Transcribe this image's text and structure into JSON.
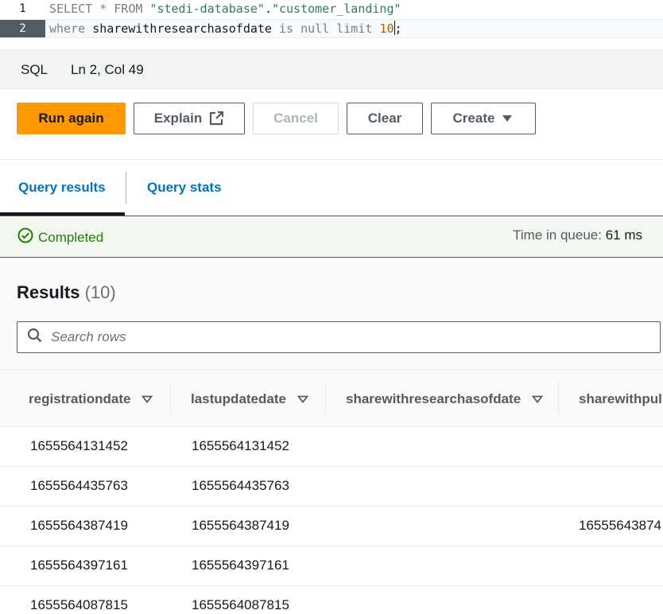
{
  "editor": {
    "line1_num": "1",
    "line2_num": "2",
    "line1": {
      "select": "SELECT * FROM ",
      "db": "\"stedi-database\"",
      "dot": ".",
      "table": "\"customer_landing\""
    },
    "line2": {
      "where": "where ",
      "field": "sharewithresearchasofdate",
      "is": " is ",
      "null": "null",
      "limit": " limit ",
      "num_a": "10",
      "num_b": "",
      "semi": ";"
    }
  },
  "status": {
    "language": "SQL",
    "position": "Ln 2, Col 49"
  },
  "actions": {
    "run_again": "Run again",
    "explain": "Explain",
    "cancel": "Cancel",
    "clear": "Clear",
    "create": "Create"
  },
  "tabs": {
    "results": "Query results",
    "stats": "Query stats"
  },
  "alert": {
    "status": "Completed",
    "queue_label": "Time in queue:",
    "queue_value": "61 ms"
  },
  "results": {
    "title": "Results",
    "count": "(10)",
    "search_placeholder": "Search rows"
  },
  "table": {
    "columns": [
      "registrationdate",
      "lastupdatedate",
      "sharewithresearchasofdate",
      "sharewithpul"
    ],
    "rows": [
      [
        "1655564131452",
        "1655564131452",
        "",
        ""
      ],
      [
        "1655564435763",
        "1655564435763",
        "",
        ""
      ],
      [
        "1655564387419",
        "1655564387419",
        "",
        "16555643874"
      ],
      [
        "1655564397161",
        "1655564397161",
        "",
        ""
      ],
      [
        "1655564087815",
        "1655564087815",
        "",
        ""
      ]
    ]
  },
  "colors": {
    "primary": "#ff9900",
    "link": "#0073bb",
    "success": "#1d8102"
  },
  "icons": [
    "external-link-icon",
    "caret-down-icon",
    "check-circle-icon",
    "search-icon",
    "sort-icon"
  ]
}
